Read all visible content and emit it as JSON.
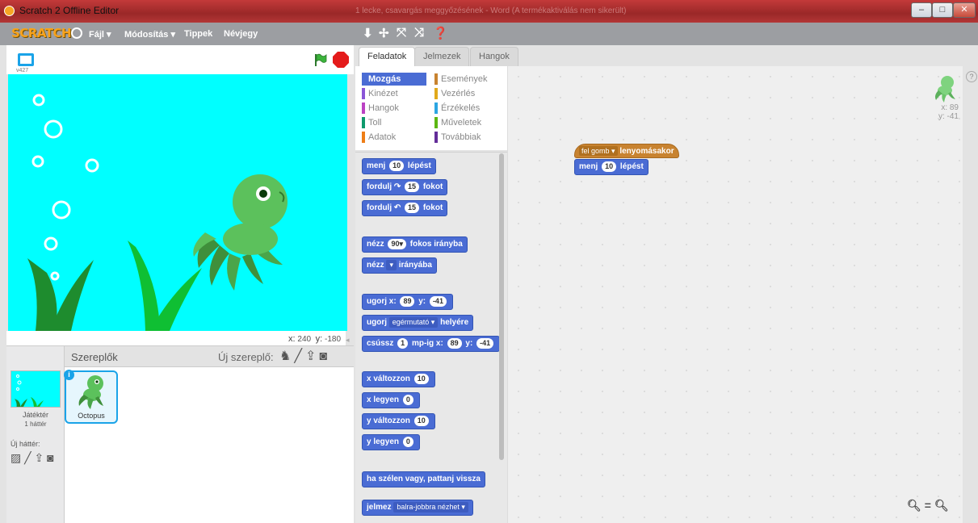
{
  "window": {
    "title": "Scratch 2 Offline Editor",
    "faded_caption": "1 lecke, csavargás meggyőzésének - Word (A termékaktiválás nem sikerült)",
    "buttons": [
      "minimize",
      "maximize",
      "close"
    ]
  },
  "menubar": {
    "logo": "SCRATCH",
    "items": [
      "Fájl ▾",
      "Módosítás ▾",
      "Tippek",
      "Névjegy"
    ],
    "tools": [
      "duplicate-icon",
      "cut-icon",
      "grow-icon",
      "shrink-icon",
      "help-icon"
    ]
  },
  "stage": {
    "version": "v427",
    "coords_x_label": "x:",
    "coords_x": "240",
    "coords_y_label": "y:",
    "coords_y": "-180"
  },
  "sprites_pane": {
    "title": "Szereplők",
    "new_sprite_label": "Új szereplő:",
    "stage_label": "Játéktér",
    "stage_sub": "1 háttér",
    "new_bg_label": "Új háttér:",
    "sprites": [
      {
        "name": "Octopus"
      }
    ]
  },
  "tabs": [
    "Feladatok",
    "Jelmezek",
    "Hangok"
  ],
  "categories": [
    {
      "label": "Mozgás",
      "color": "#4a6cd4",
      "active": true
    },
    {
      "label": "Események",
      "color": "#c88330"
    },
    {
      "label": "Kinézet",
      "color": "#8a55d7"
    },
    {
      "label": "Vezérlés",
      "color": "#e1a91a"
    },
    {
      "label": "Hangok",
      "color": "#bb42c3"
    },
    {
      "label": "Érzékelés",
      "color": "#2ca5e2"
    },
    {
      "label": "Toll",
      "color": "#0e9a6c"
    },
    {
      "label": "Műveletek",
      "color": "#5cb712"
    },
    {
      "label": "Adatok",
      "color": "#ee7d16"
    },
    {
      "label": "Továbbiak",
      "color": "#632d99"
    }
  ],
  "blocks": {
    "move": {
      "pre": "menj",
      "n": "10",
      "post": "lépést"
    },
    "turn_right": {
      "pre": "fordulj ↷",
      "n": "15",
      "post": "fokot"
    },
    "turn_left": {
      "pre": "fordulj ↶",
      "n": "15",
      "post": "fokot"
    },
    "point_dir": {
      "pre": "nézz",
      "n": "90▾",
      "post": "fokos irányba"
    },
    "point_towards": {
      "pre": "nézz",
      "n": "▾",
      "post": "irányába"
    },
    "goto_xy": {
      "pre": "ugorj x:",
      "x": "89",
      "mid": "y:",
      "y": "-41"
    },
    "goto": {
      "pre": "ugorj",
      "dd": "egérmutató ▾",
      "post": "helyére"
    },
    "glide": {
      "pre": "csússz",
      "n": "1",
      "mid": "mp-ig x:",
      "x": "89",
      "mid2": "y:",
      "y": "-41"
    },
    "change_x": {
      "pre": "x változzon",
      "n": "10"
    },
    "set_x": {
      "pre": "x legyen",
      "n": "0"
    },
    "change_y": {
      "pre": "y változzon",
      "n": "10"
    },
    "set_y": {
      "pre": "y legyen",
      "n": "0"
    },
    "bounce": {
      "pre": "ha szélen vagy, pattanj vissza"
    },
    "rotation_style": {
      "pre": "jelmez",
      "dd": "balra-jobbra nézhet ▾"
    }
  },
  "script": {
    "hat_dd": "fel gomb ▾",
    "hat_text": "lenyomásakor",
    "move_pre": "menj",
    "move_n": "10",
    "move_post": "lépést"
  },
  "sprite_info": {
    "x": "x: 89",
    "y": "y: -41"
  },
  "zoom": [
    "zoom-out-icon",
    "zoom-reset-icon",
    "zoom-in-icon"
  ]
}
